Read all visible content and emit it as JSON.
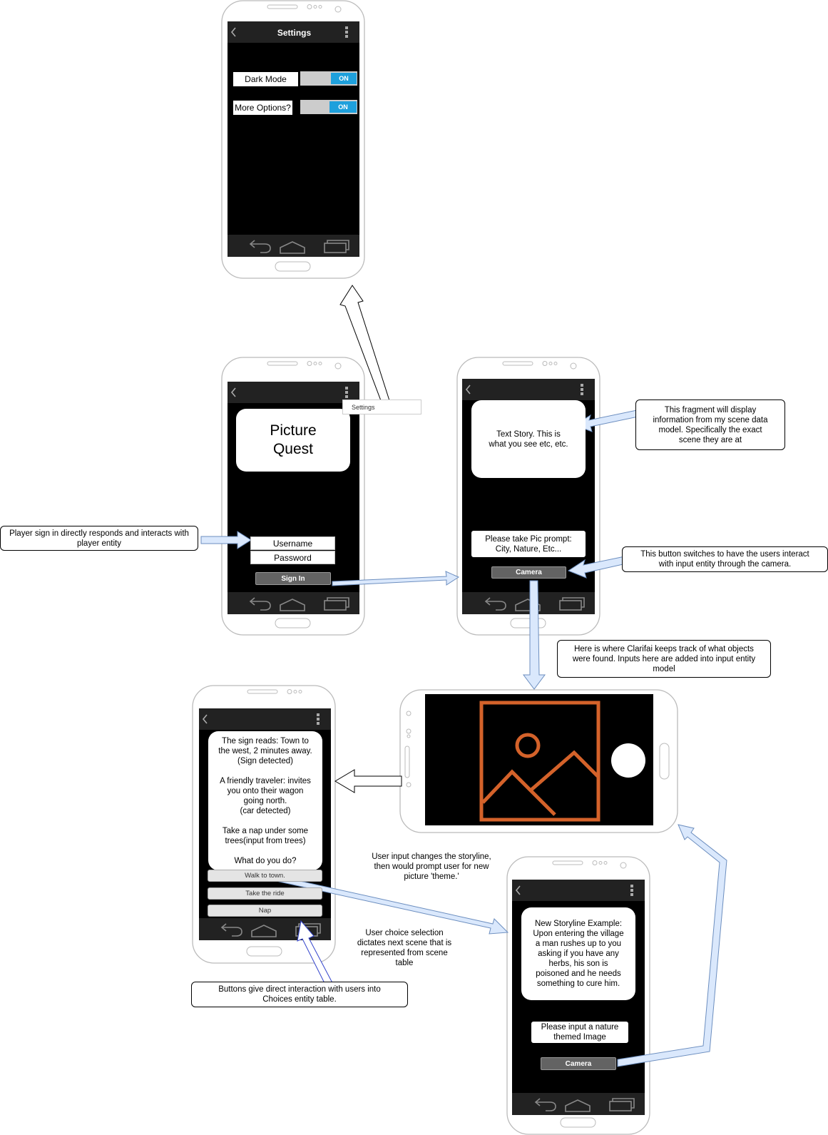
{
  "settings_phone": {
    "title": "Settings",
    "dark_mode_label": "Dark Mode",
    "dark_mode_value": "ON",
    "more_options_label": "More Options?",
    "more_options_value": "ON"
  },
  "login_phone": {
    "app_title": "Picture\nQuest",
    "menu_item": "Settings",
    "username": "Username",
    "password": "Password",
    "signin": "Sign In"
  },
  "story_phone": {
    "story_text": "Text Story. This is\nwhat you see etc, etc.",
    "prompt": "Please take Pic prompt:\nCity, Nature, Etc...",
    "camera": "Camera"
  },
  "choices_phone": {
    "story_text": "The sign reads: Town to\nthe west, 2 minutes away.\n(Sign detected)\n\nA friendly traveler: invites\nyou onto their wagon\ngoing north.\n(car detected)\n\nTake a nap under some\ntrees(input from trees)\n\nWhat do you do?",
    "choices": [
      "Walk to town.",
      "Take the ride",
      "Nap"
    ]
  },
  "new_story_phone": {
    "story_text": "New Storyline Example:\nUpon entering the village\na man rushes up to you\nasking if you have any\nherbs, his son is\npoisoned and he needs\nsomething to cure him.",
    "prompt": "Please input a nature\nthemed Image",
    "camera": "Camera"
  },
  "annotations": {
    "player_sign_in": "Player sign in directly responds and interacts with\nplayer entity",
    "fragment_display": "This fragment will display\ninformation from my scene data\nmodel. Specifically the exact\nscene they are at",
    "camera_button": "This button switches to have the users interact\nwith input entity through the camera.",
    "clarifai": "Here is where Clarifai keeps track of what objects\nwere found. Inputs here are added into input entity\nmodel",
    "user_input": "User input changes the storyline,\nthen would prompt user for new\npicture 'theme.'",
    "user_choice": "User choice selection\ndictates next scene that is\nrepresented from scene\ntable",
    "buttons": "Buttons give direct interaction with users into\nChoices entity table."
  },
  "colors": {
    "screen": "#000000",
    "arrow_fill": "#dae8fc",
    "arrow_stroke": "#6c8ebf",
    "image_icon": "#d4622a",
    "toggle_on": "#1ea0dc",
    "button_dark": "#636363"
  }
}
